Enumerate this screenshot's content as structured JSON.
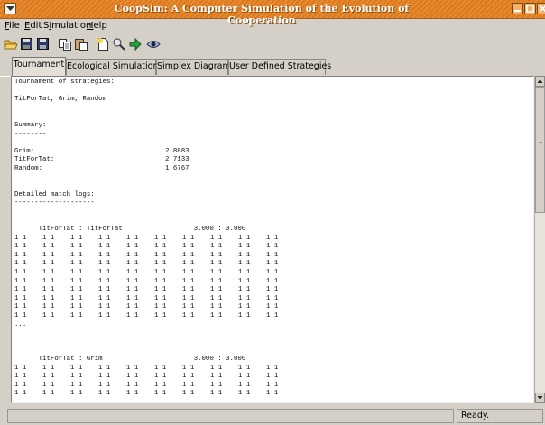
{
  "window": {
    "title": "CoopSim: A Computer Simulation of the Evolution of Cooperation"
  },
  "menu": {
    "file": "File",
    "edit": "Edit",
    "simulation": "Simulation",
    "help": "Help"
  },
  "toolbar": [
    "open-folder-icon",
    "save-icon",
    "save-as-icon",
    "copy-icon",
    "paste-icon",
    "new-document-icon",
    "search-icon",
    "forward-arrow-icon",
    "eye-icon"
  ],
  "tabs": [
    "Tournament",
    "Ecological Simulation",
    "Simplex Diagram",
    "User Defined Strategies"
  ],
  "active_tab": "Tournament",
  "output": {
    "heading": "Tournament of strategies:",
    "strategies": "TitForTat, Grim, Random",
    "summary_title": "Summary:",
    "summary_rule": "--------",
    "scores": [
      {
        "name": "Grim:",
        "value": "2.8883"
      },
      {
        "name": "TitForTat:",
        "value": "2.7133"
      },
      {
        "name": "Random:",
        "value": "1.6767"
      }
    ],
    "logs_title": "Detailed match logs:",
    "logs_rule": "--------------------",
    "matches": [
      {
        "pair": "TitForTat : TitForTat",
        "score": "3.000 : 3.000",
        "row_count": 10,
        "ellipsis": "..."
      },
      {
        "pair": "TitForTat : Grim",
        "score": "3.000 : 3.000",
        "row_count": 4
      }
    ],
    "cell": "1 1",
    "cells_per_row": 10
  },
  "status": {
    "message": "",
    "ready": "Ready."
  }
}
